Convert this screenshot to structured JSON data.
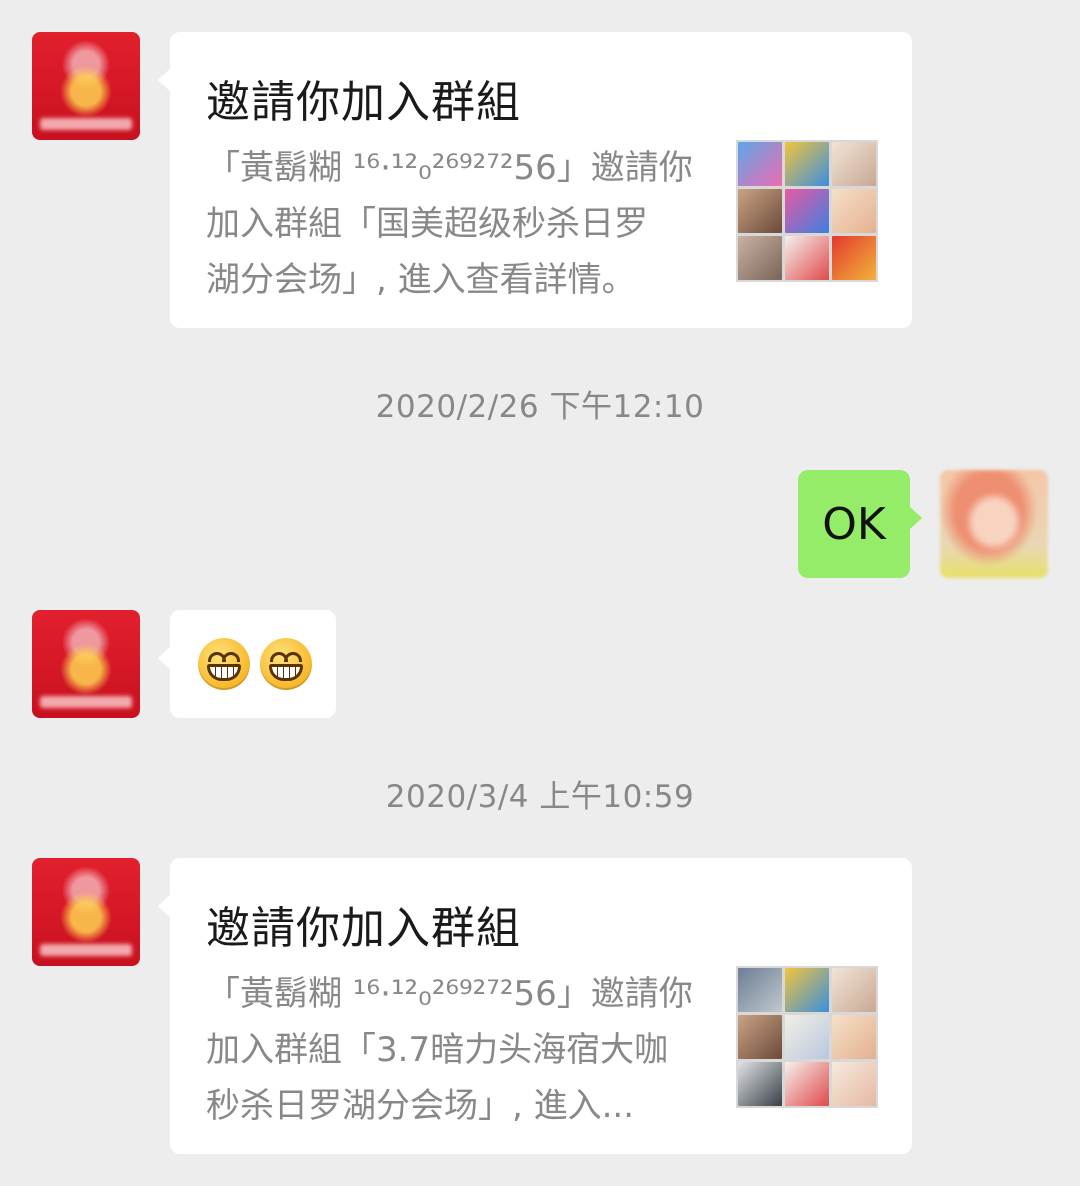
{
  "messages": [
    {
      "kind": "invite-card",
      "title": "邀請你加入群組",
      "description": "「黃鬍糊 ¹⁶·¹²₀²⁶⁹²⁷²56」邀請你\n加入群組「国美超级秒杀日罗\n湖分会场」, 進入查看詳情。"
    },
    {
      "kind": "timestamp",
      "text": "2020/2/26 下午12:10"
    },
    {
      "kind": "text-self",
      "text": "OK"
    },
    {
      "kind": "emoji",
      "emojis": [
        "grin-emoji",
        "grin-emoji"
      ]
    },
    {
      "kind": "timestamp",
      "text": "2020/3/4 上午10:59"
    },
    {
      "kind": "invite-card",
      "title": "邀請你加入群組",
      "description": "「黃鬍糊 ¹⁶·¹²₀²⁶⁹²⁷²56」邀請你\n加入群組「3.7暗力头海宿大咖\n秒杀日罗湖分会场」, 進入..."
    }
  ],
  "colors": {
    "background": "#ededed",
    "bubble_in": "#ffffff",
    "bubble_out": "#95ec69",
    "timestamp_text": "#888888"
  }
}
